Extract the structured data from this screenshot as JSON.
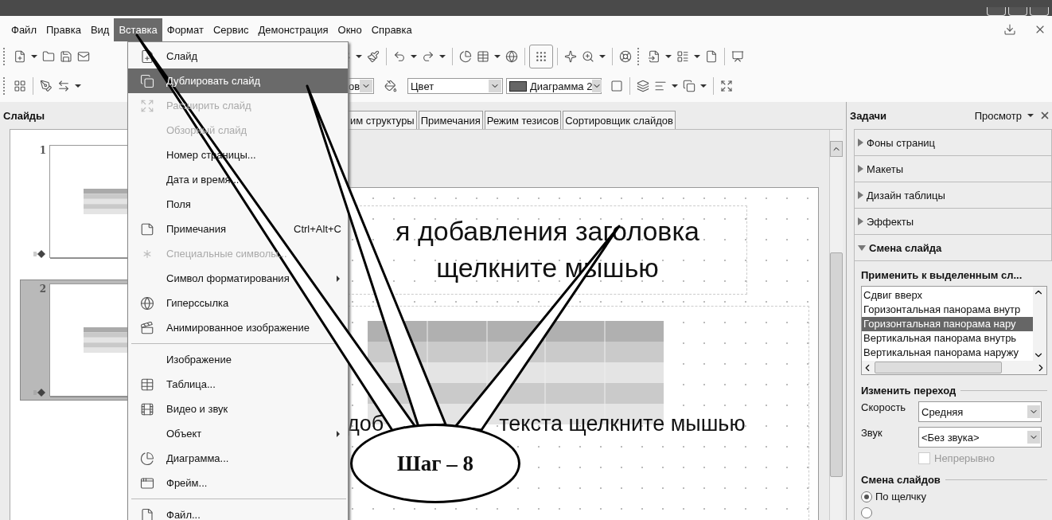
{
  "menubar": {
    "items": [
      {
        "label": "Файл",
        "selected": false
      },
      {
        "label": "Правка",
        "selected": false
      },
      {
        "label": "Вид",
        "selected": false
      },
      {
        "label": "Вставка",
        "selected": true
      },
      {
        "label": "Формат",
        "selected": false
      },
      {
        "label": "Сервис",
        "selected": false
      },
      {
        "label": "Демонстрация",
        "selected": false
      },
      {
        "label": "Окно",
        "selected": false
      },
      {
        "label": "Справка",
        "selected": false
      }
    ]
  },
  "toolbar": {
    "font_field": "ов",
    "color_field": "Цвет",
    "style_field": "Диаграмма 2"
  },
  "slides_panel": {
    "title": "Слайды",
    "slides": [
      {
        "number": "1",
        "selected": false
      },
      {
        "number": "2",
        "selected": true
      }
    ]
  },
  "view_tabs": [
    {
      "label": "им структуры",
      "selected": false
    },
    {
      "label": "Примечания",
      "selected": false
    },
    {
      "label": "Режим тезисов",
      "selected": false
    },
    {
      "label": "Сортировщик слайдов",
      "selected": false
    }
  ],
  "slide": {
    "title_lines": [
      "я добавления заголовка",
      "щелкните мышью"
    ],
    "body_parts": [
      "доб",
      "текста щелкните мышью"
    ]
  },
  "insert_menu": {
    "items": [
      {
        "kind": "item",
        "label": "Слайд",
        "disabled": false,
        "selected": false
      },
      {
        "kind": "item",
        "label": "Дублировать слайд",
        "disabled": false,
        "selected": true
      },
      {
        "kind": "item",
        "label": "Расширить слайд",
        "disabled": true,
        "selected": false
      },
      {
        "kind": "item",
        "label": "Обзорный слайд",
        "disabled": true,
        "selected": false
      },
      {
        "kind": "item",
        "label": "Номер страницы...",
        "disabled": false,
        "selected": false
      },
      {
        "kind": "item",
        "label": "Дата и время...",
        "disabled": false,
        "selected": false
      },
      {
        "kind": "item",
        "label": "Поля",
        "disabled": false,
        "selected": false
      },
      {
        "kind": "item",
        "label": "Примечания",
        "shortcut": "Ctrl+Alt+C",
        "disabled": false,
        "selected": false
      },
      {
        "kind": "item",
        "label": "Специальные символы...",
        "disabled": true,
        "selected": false
      },
      {
        "kind": "submenu",
        "label": "Символ форматирования",
        "disabled": false,
        "selected": false
      },
      {
        "kind": "item",
        "label": "Гиперссылка",
        "disabled": false,
        "selected": false
      },
      {
        "kind": "item",
        "label": "Анимированное изображение",
        "disabled": false,
        "selected": false
      },
      {
        "kind": "separator"
      },
      {
        "kind": "item",
        "label": "Изображение",
        "disabled": false,
        "selected": false
      },
      {
        "kind": "item",
        "label": "Таблица...",
        "disabled": false,
        "selected": false
      },
      {
        "kind": "item",
        "label": "Видео и звук",
        "disabled": false,
        "selected": false
      },
      {
        "kind": "submenu",
        "label": "Объект",
        "disabled": false,
        "selected": false
      },
      {
        "kind": "item",
        "label": "Диаграмма...",
        "disabled": false,
        "selected": false
      },
      {
        "kind": "item",
        "label": "Фрейм...",
        "disabled": false,
        "selected": false
      },
      {
        "kind": "separator"
      },
      {
        "kind": "item",
        "label": "Файл...",
        "disabled": false,
        "selected": false
      }
    ]
  },
  "task_pane": {
    "title": "Задачи",
    "view_menu": "Просмотр",
    "sections": [
      {
        "label": "Фоны страниц",
        "expanded": false
      },
      {
        "label": "Макеты",
        "expanded": false
      },
      {
        "label": "Дизайн таблицы",
        "expanded": false
      },
      {
        "label": "Эффекты",
        "expanded": false
      },
      {
        "label": "Смена слайда",
        "expanded": true
      }
    ],
    "apply_label": "Применить к выделенным сл...",
    "transitions": [
      {
        "label": "Сдвиг вверх",
        "selected": false
      },
      {
        "label": "Горизонтальная панорама внутр",
        "selected": false
      },
      {
        "label": "Горизонтальная панорама нару",
        "selected": true
      },
      {
        "label": "Вертикальная панорама внутрь",
        "selected": false
      },
      {
        "label": "Вертикальная панорама наружу",
        "selected": false
      }
    ],
    "modify_heading": "Изменить переход",
    "speed_label": "Скорость",
    "speed_value": "Средняя",
    "sound_label": "Звук",
    "sound_value": "<Без звука>",
    "loop": {
      "label": "Непрерывно",
      "checked": false,
      "disabled": true
    },
    "advance_heading": "Смена слайдов",
    "advance_options": [
      {
        "label": "По щелчку",
        "selected": true
      },
      {
        "selected": false
      }
    ]
  },
  "callout": {
    "text": "Шаг – 8"
  }
}
